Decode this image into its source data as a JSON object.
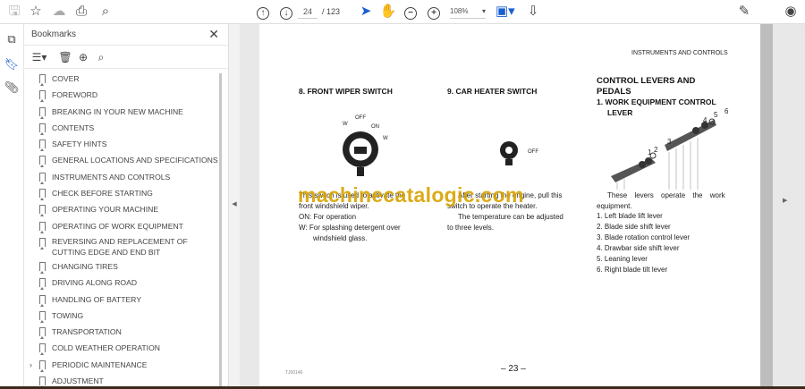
{
  "toolbar": {
    "page_current": "24",
    "page_total": "/ 123",
    "zoom": "108%"
  },
  "bookmarks": {
    "title": "Bookmarks",
    "items": [
      {
        "label": "COVER"
      },
      {
        "label": "FOREWORD"
      },
      {
        "label": "BREAKING IN YOUR NEW MACHINE"
      },
      {
        "label": "CONTENTS"
      },
      {
        "label": "SAFETY HINTS"
      },
      {
        "label": "GENERAL LOCATIONS AND SPECIFICATIONS"
      },
      {
        "label": "INSTRUMENTS AND CONTROLS"
      },
      {
        "label": "CHECK BEFORE STARTING"
      },
      {
        "label": "OPERATING YOUR MACHINE"
      },
      {
        "label": "OPERATING OF WORK EQUIPMENT"
      },
      {
        "label": "REVERSING AND REPLACEMENT OF CUTTING EDGE AND END BIT"
      },
      {
        "label": "CHANGING TIRES"
      },
      {
        "label": "DRIVING ALONG ROAD"
      },
      {
        "label": "HANDLING OF BATTERY"
      },
      {
        "label": "TOWING"
      },
      {
        "label": "TRANSPORTATION"
      },
      {
        "label": "COLD WEATHER OPERATION"
      },
      {
        "label": "PERIODIC MAINTENANCE"
      },
      {
        "label": "ADJUSTMENT"
      }
    ]
  },
  "page": {
    "header": "INSTRUMENTS AND CONTROLS",
    "s8_title": "8. FRONT WIPER SWITCH",
    "s8_labels": {
      "off": "OFF",
      "on": "ON",
      "w1": "W",
      "w2": "W"
    },
    "s8_l1": "This switch is used to activate the",
    "s8_l2": "front windshield wiper.",
    "s8_l3": "ON: For operation",
    "s8_l4": "W:  For splashing detergent over",
    "s8_l5": "windshield glass.",
    "s9_title": "9. CAR HEATER SWITCH",
    "s9_off": "OFF",
    "s9_l1": "After starting the engine, pull this",
    "s9_l2": "switch to operate the heater.",
    "s9_l3": "The temperature can be adjusted",
    "s9_l4": "to three levels.",
    "c_title1": "CONTROL LEVERS AND",
    "c_title2": "PEDALS",
    "c_sub1": "1.  WORK EQUIPMENT CONTROL",
    "c_sub2": "LEVER",
    "c_nums": [
      "1",
      "2",
      "3",
      "4",
      "5",
      "6"
    ],
    "c_l1": "These levers operate the work",
    "c_l2": "equipment.",
    "c_items": [
      "1.  Left blade lift lever",
      "2.  Blade side shift lever",
      "3.  Blade rotation control lever",
      "4.  Drawbar side shift lever",
      "5.  Leaning lever",
      "6.  Right blade tilt lever"
    ],
    "footer_code": "TJ00146",
    "page_number": "– 23 –",
    "watermark": "machinecatalogic.com"
  }
}
